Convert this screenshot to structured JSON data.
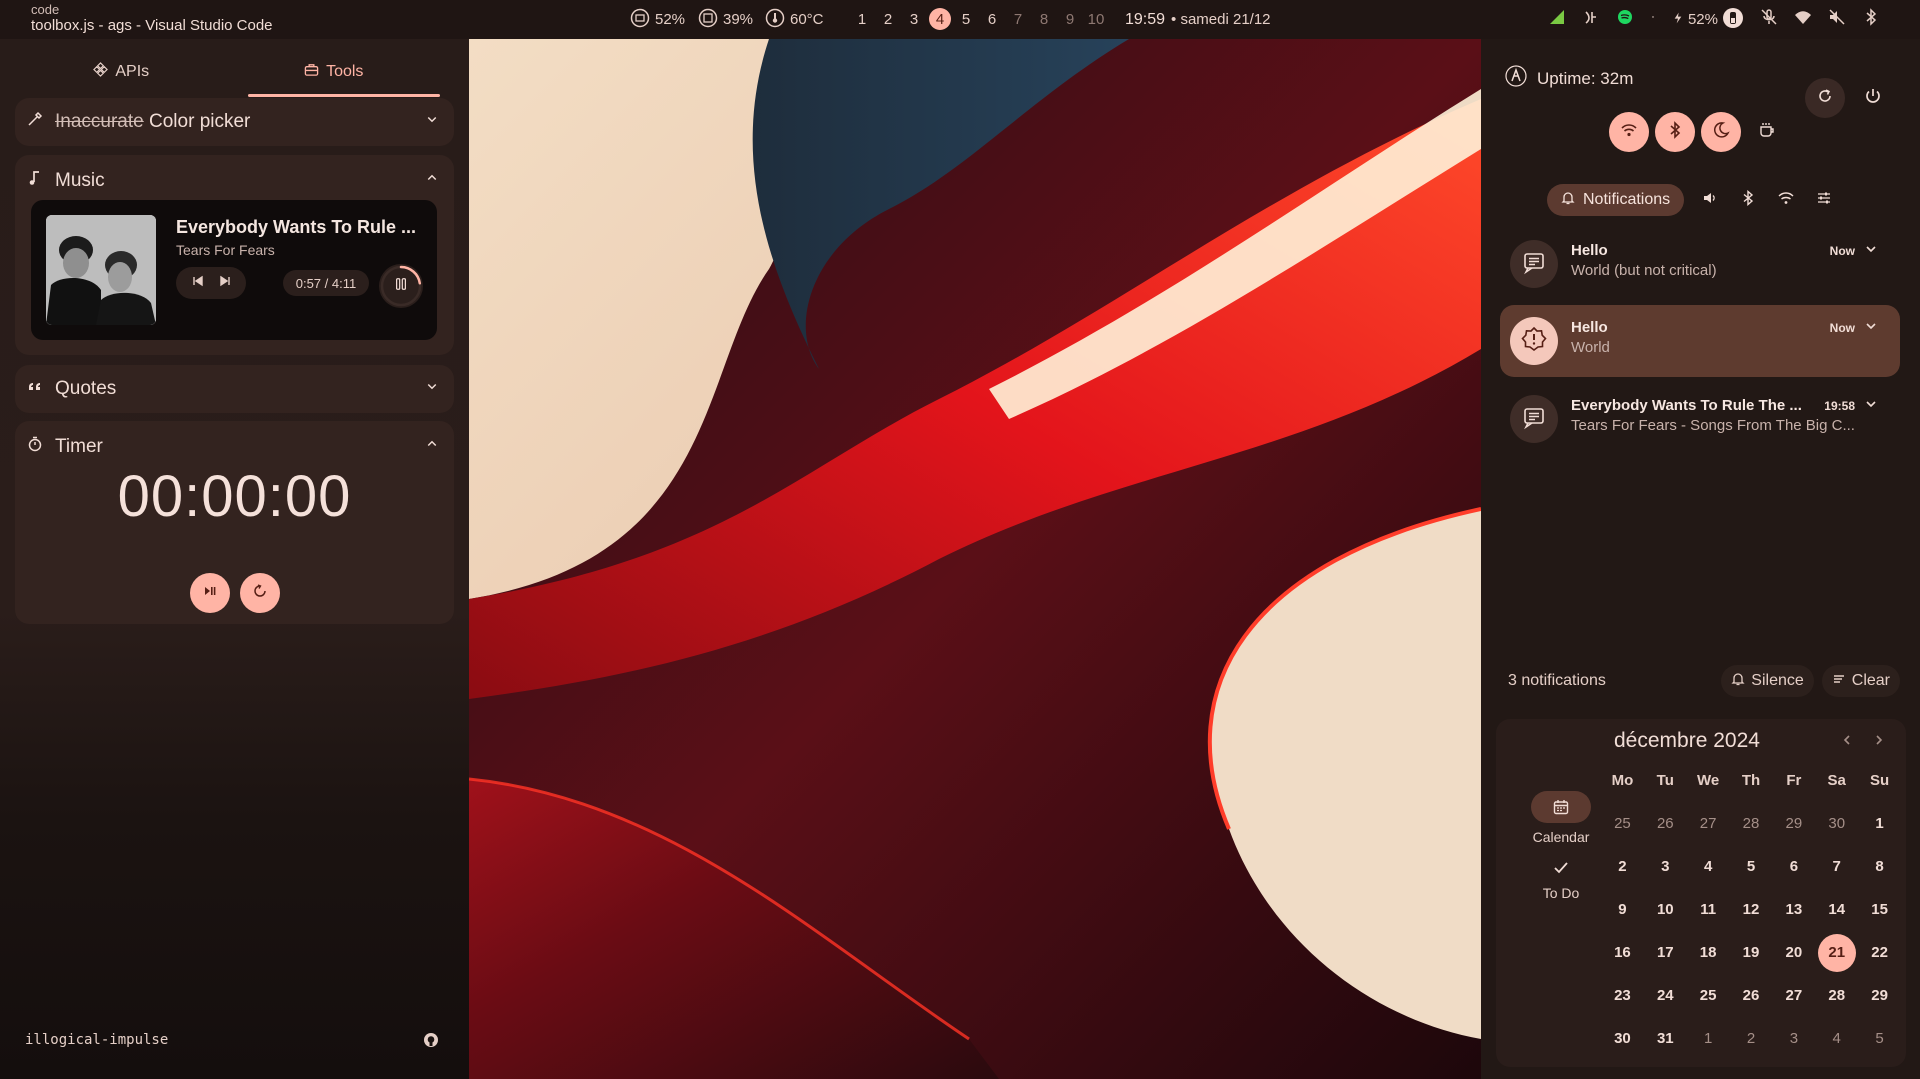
{
  "topbar": {
    "window_class": "code",
    "window_title": "toolbox.js - ags - Visual Studio Code",
    "ram": "52%",
    "swap": "39%",
    "temp": "60°C",
    "workspaces": [
      "1",
      "2",
      "3",
      "4",
      "5",
      "6",
      "7",
      "8",
      "9",
      "10"
    ],
    "active_workspace": "4",
    "time": "19:59",
    "date": "• samedi 21/12",
    "battery": "52%"
  },
  "left": {
    "tabs": [
      {
        "label": "APIs",
        "icon": "apis-icon"
      },
      {
        "label": "Tools",
        "icon": "toolbox-icon"
      }
    ],
    "color_picker": {
      "struck": "Inaccurate",
      "title": "Color picker"
    },
    "music": {
      "title": "Music",
      "track_title": "Everybody Wants To Rule ...",
      "track_artist": "Tears For Fears",
      "position": "0:57",
      "separator": "/",
      "duration": "4:11",
      "progress": 0.227
    },
    "quotes": {
      "title": "Quotes"
    },
    "timer": {
      "title": "Timer",
      "value": "00:00:00"
    },
    "brand": "illogical-impulse"
  },
  "right": {
    "uptime": "Uptime: 32m",
    "tabs": {
      "notifications": "Notifications"
    },
    "notifications": [
      {
        "title": "Hello",
        "body": "World (but not critical)",
        "time": "Now",
        "urgent": false
      },
      {
        "title": "Hello",
        "body": "World",
        "time": "Now",
        "urgent": true
      },
      {
        "title": "Everybody Wants To Rule The ...",
        "body": "Tears For Fears - Songs From The Big C...",
        "time": "19:58",
        "urgent": false
      }
    ],
    "count": "3 notifications",
    "silence": "Silence",
    "clear": "Clear",
    "calendar": {
      "month": "décembre 2024",
      "nav": [
        {
          "label": "Calendar"
        },
        {
          "label": "To Do"
        }
      ],
      "weekdays": [
        "Mo",
        "Tu",
        "We",
        "Th",
        "Fr",
        "Sa",
        "Su"
      ],
      "weeks": [
        [
          "25",
          "26",
          "27",
          "28",
          "29",
          "30",
          "1"
        ],
        [
          "2",
          "3",
          "4",
          "5",
          "6",
          "7",
          "8"
        ],
        [
          "9",
          "10",
          "11",
          "12",
          "13",
          "14",
          "15"
        ],
        [
          "16",
          "17",
          "18",
          "19",
          "20",
          "21",
          "22"
        ],
        [
          "23",
          "24",
          "25",
          "26",
          "27",
          "28",
          "29"
        ],
        [
          "30",
          "31",
          "1",
          "2",
          "3",
          "4",
          "5"
        ]
      ],
      "today": "21"
    }
  },
  "colors": {
    "accent": "#ffb4a5",
    "surface": "#33231f",
    "background": "#221815"
  }
}
